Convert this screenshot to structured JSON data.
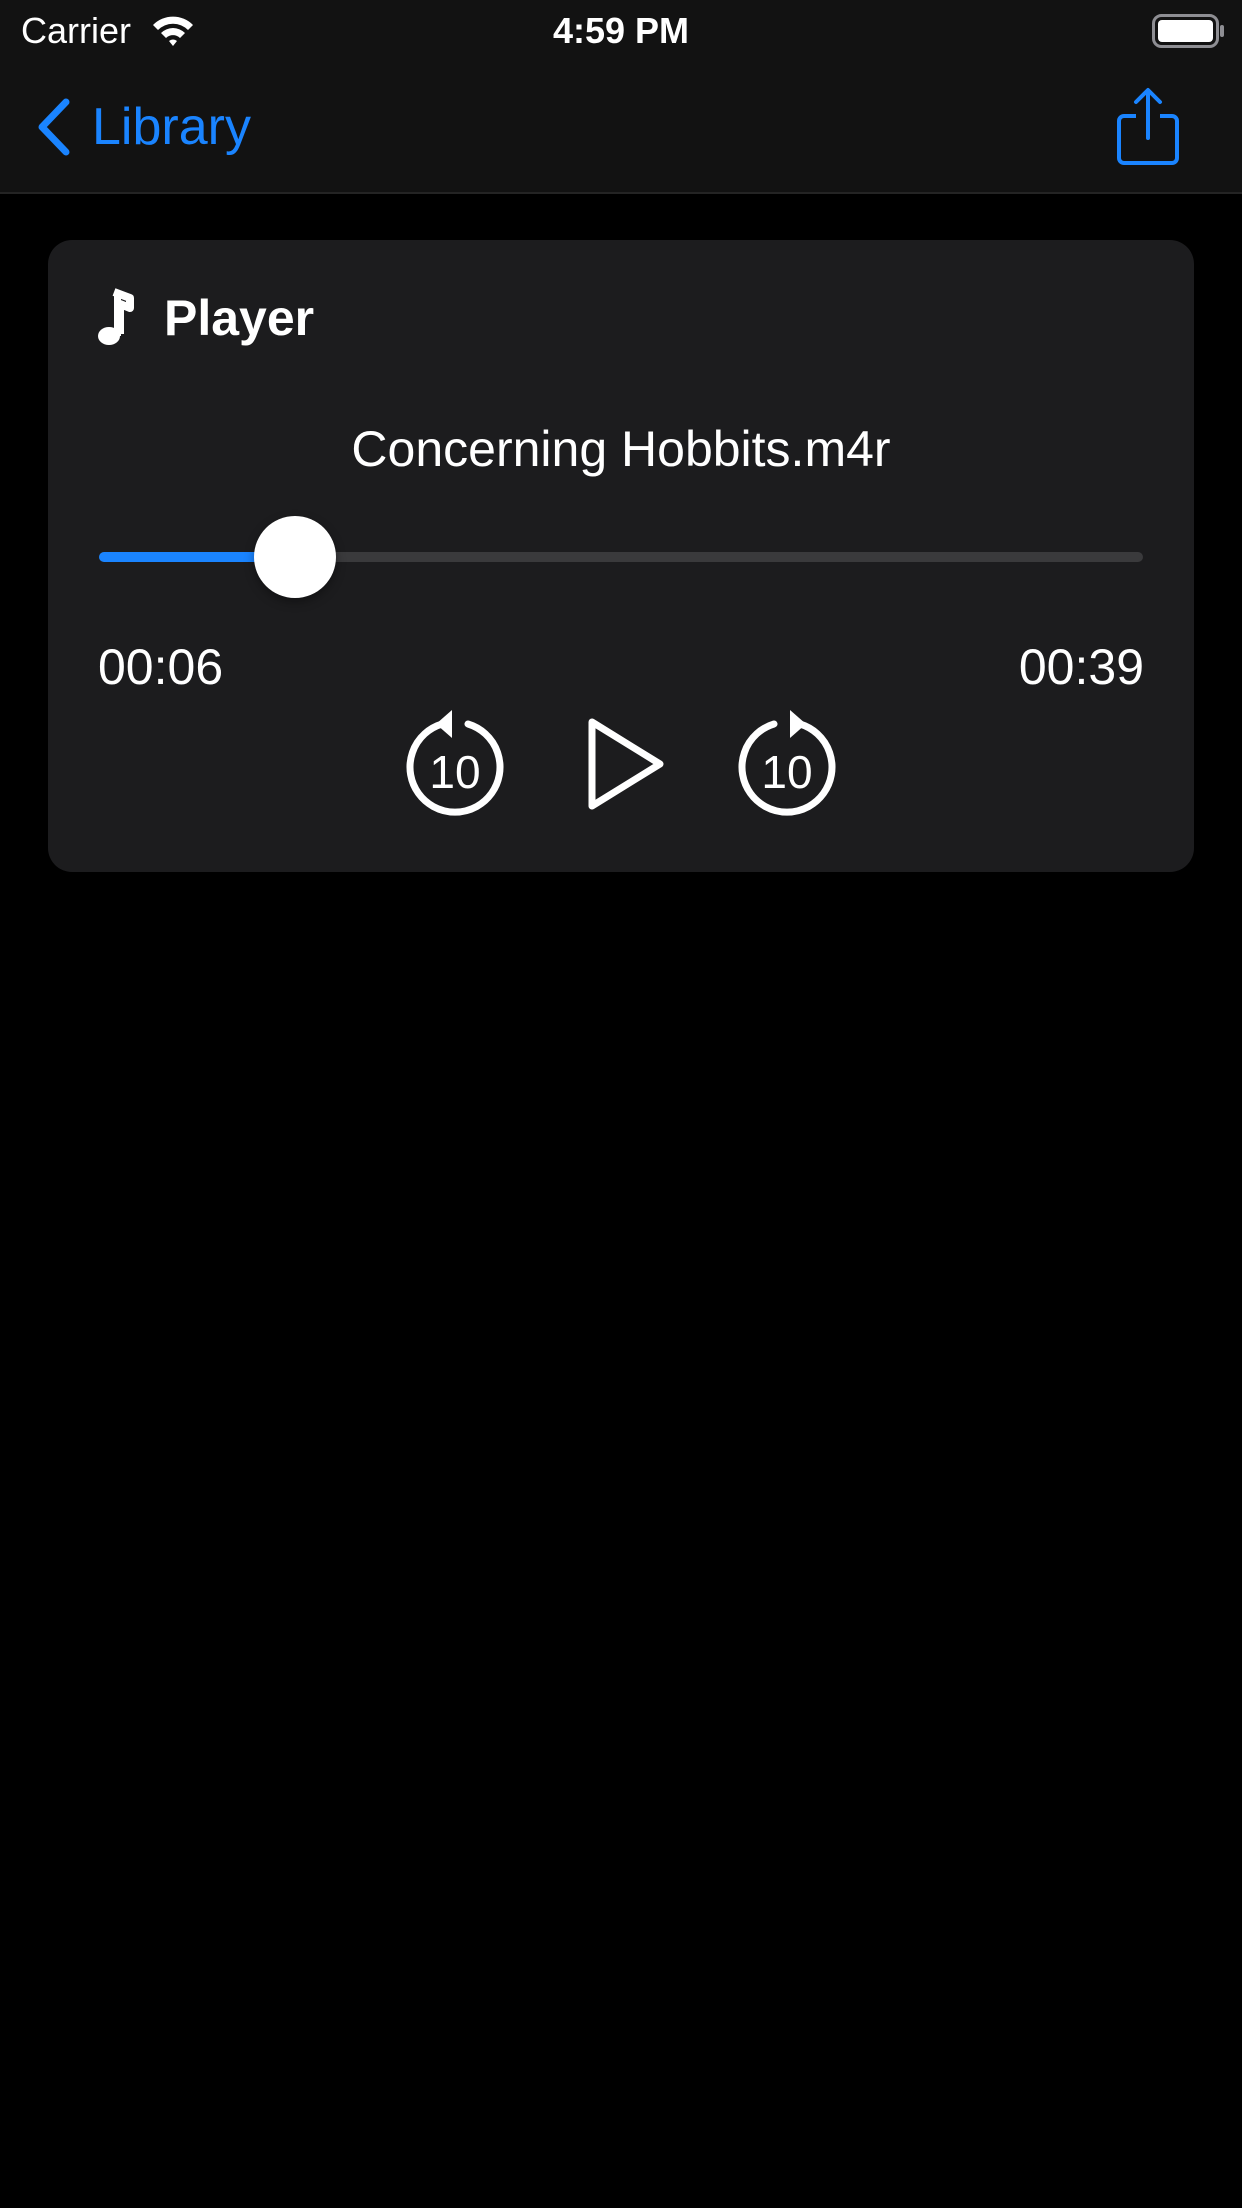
{
  "status_bar": {
    "carrier": "Carrier",
    "time": "4:59 PM"
  },
  "nav": {
    "back_label": "Library",
    "back_icon": "chevron-left-icon",
    "share_icon": "share-icon"
  },
  "player": {
    "title": "Player",
    "title_icon": "music-note-icon",
    "track_name": "Concerning Hobbits.m4r",
    "elapsed": "00:06",
    "duration": "00:39",
    "progress_fraction": 0.188,
    "skip_back_label": "10",
    "skip_forward_label": "10",
    "play_icon": "play-icon"
  },
  "colors": {
    "accent": "#1a84ff",
    "background": "#000000",
    "bar_background": "#121212",
    "card_background": "#1c1c1e",
    "track_background": "#3a3a3c"
  }
}
